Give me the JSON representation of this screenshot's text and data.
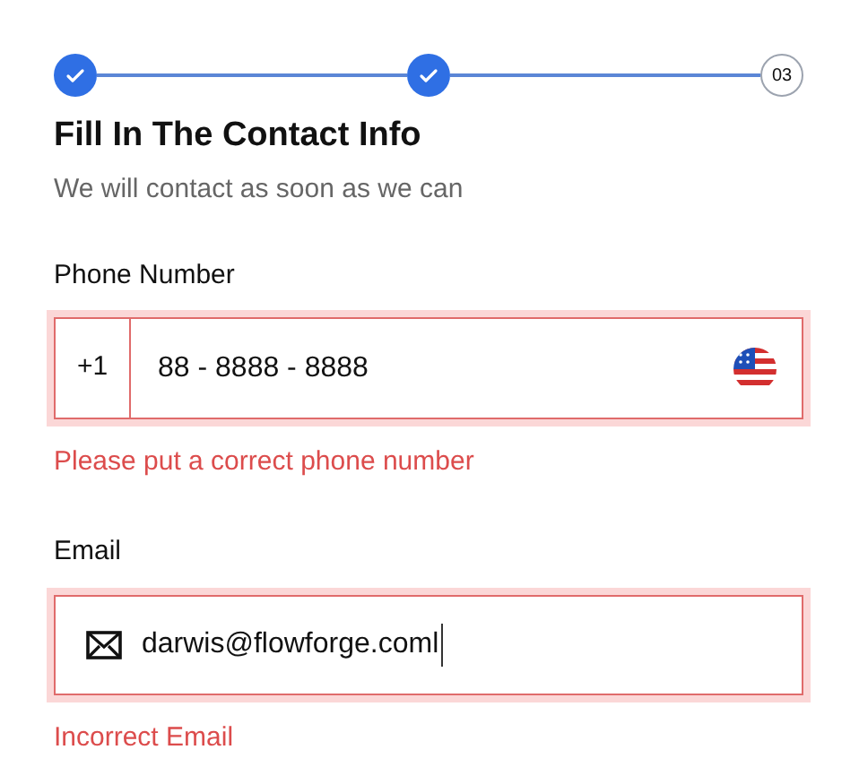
{
  "steps": [
    {
      "completed": true
    },
    {
      "completed": true
    },
    {
      "label": "03",
      "completed": false
    }
  ],
  "title": "Fill In The Contact Info",
  "subtitle": "We will contact as soon as we can",
  "fields": [
    {
      "kind": "phone",
      "label": "Phone Number",
      "prefix": "+1",
      "value": "88 - 8888 - 8888",
      "invalid": true,
      "error": "Please put a correct phone number"
    },
    {
      "kind": "email",
      "label": "Email",
      "value": "darwis@flowforge.coml",
      "invalid": true,
      "focused": true,
      "error": "Incorrect Email"
    }
  ]
}
